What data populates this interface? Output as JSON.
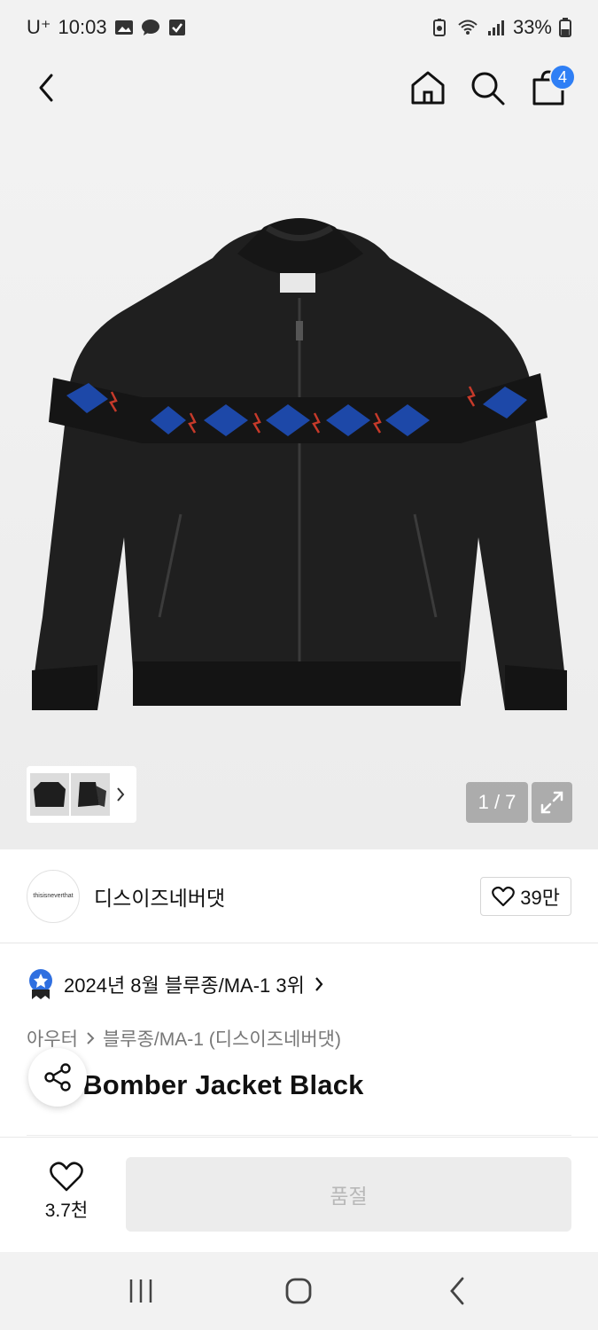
{
  "status_bar": {
    "carrier": "U⁺",
    "time": "10:03",
    "battery": "33%",
    "icons": [
      "gallery-icon",
      "chat-icon",
      "check-icon",
      "battery-saver-icon",
      "wifi-icon",
      "signal-icon",
      "battery-icon"
    ]
  },
  "nav": {
    "back_icon": "chevron-left-icon",
    "home_icon": "home-icon",
    "search_icon": "search-icon",
    "cart_icon": "shopping-bag-icon",
    "cart_count": "4",
    "badge_color": "#2f7ff5"
  },
  "gallery": {
    "counter": "1 / 7",
    "expand_icon": "expand-icon",
    "thumbs_more_icon": "chevron-right-icon"
  },
  "brand": {
    "logo_text": "thisisneverthat",
    "name": "디스이즈네버댓",
    "likes": "39만",
    "like_icon": "heart-icon"
  },
  "ranking": {
    "badge_icon": "ranking-badge-icon",
    "text": "2024년 8월 블루종/MA-1 3위",
    "badge_color": "#2f6fe0"
  },
  "breadcrumb": {
    "category": "아우터",
    "subcategory": "블루종/MA-1 (디스이즈네버댓)"
  },
  "product": {
    "title_visible": "d Bomber Jacket Black",
    "share_icon": "share-icon"
  },
  "action_bar": {
    "wish_count": "3.7천",
    "wish_icon": "heart-icon",
    "buy_label": "품절"
  },
  "android_nav": {
    "recents_icon": "recents-icon",
    "home_icon": "home-circle-icon",
    "back_icon": "back-icon"
  }
}
